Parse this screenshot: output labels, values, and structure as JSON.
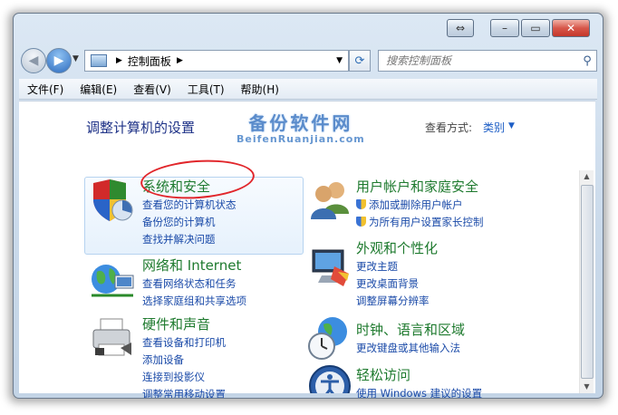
{
  "window": {
    "caption_buttons": {
      "minimize": "–",
      "maximize": "▭",
      "close": "✕",
      "extra": "⇔"
    }
  },
  "nav": {
    "back_glyph": "◀",
    "forward_glyph": "▶",
    "address_segments": [
      "控制面板"
    ],
    "search_placeholder": "搜索控制面板",
    "refresh_glyph": "⟳",
    "search_icon": "search-icon"
  },
  "menu": [
    "文件(F)",
    "编辑(E)",
    "查看(V)",
    "工具(T)",
    "帮助(H)"
  ],
  "page": {
    "title": "调整计算机的设置",
    "view_by_label": "查看方式:",
    "view_by_value": "类别"
  },
  "watermark": {
    "line1": "备份软件网",
    "line2": "BeifenRuanjian.com"
  },
  "categories": [
    {
      "title": "系统和安全",
      "icon": "shield-icon",
      "links": [
        "查看您的计算机状态",
        "备份您的计算机",
        "查找并解决问题"
      ]
    },
    {
      "title": "网络和 Internet",
      "icon": "network-globe-icon",
      "links": [
        "查看网络状态和任务",
        "选择家庭组和共享选项"
      ]
    },
    {
      "title": "硬件和声音",
      "icon": "printer-icon",
      "links": [
        "查看设备和打印机",
        "添加设备",
        "连接到投影仪",
        "调整常用移动设置"
      ]
    },
    {
      "title": "用户帐户和家庭安全",
      "icon": "users-icon",
      "links": [
        "添加或删除用户帐户",
        "为所有用户设置家长控制"
      ]
    },
    {
      "title": "外观和个性化",
      "icon": "display-icon",
      "links": [
        "更改主题",
        "更改桌面背景",
        "调整屏幕分辨率"
      ]
    },
    {
      "title": "时钟、语言和区域",
      "icon": "clock-globe-icon",
      "links": [
        "更改键盘或其他输入法"
      ]
    },
    {
      "title": "轻松访问",
      "icon": "ease-of-access-icon",
      "links": [
        "使用 Windows 建议的设置"
      ]
    }
  ],
  "colors": {
    "category_title": "#1e7a2e",
    "link": "#1a4aa8",
    "highlight_border": "#b6d3f0",
    "annotation_circle": "#e1262b"
  }
}
